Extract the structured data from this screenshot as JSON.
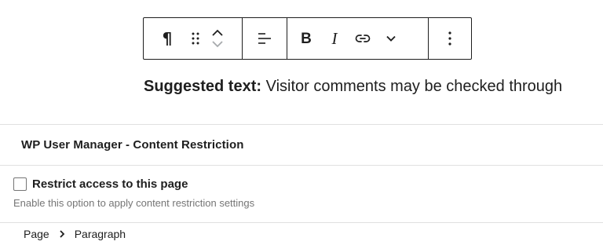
{
  "toolbar": {
    "block_type": {
      "icon": "paragraph-icon",
      "glyph": "¶"
    },
    "drag": {
      "icon": "drag-handle-icon"
    },
    "move_up": {
      "icon": "chevron-up-icon"
    },
    "move_down": {
      "icon": "chevron-down-icon"
    },
    "align": {
      "icon": "align-left-icon"
    },
    "bold": {
      "icon": "bold-icon",
      "glyph": "B"
    },
    "italic": {
      "icon": "italic-icon",
      "glyph": "I"
    },
    "link": {
      "icon": "link-icon"
    },
    "more_formatting": {
      "icon": "chevron-down-icon"
    },
    "options": {
      "icon": "more-vertical-icon"
    }
  },
  "content": {
    "suggested_label": "Suggested text:",
    "suggested_text": " Visitor comments may be checked through"
  },
  "panel": {
    "title": "WP User Manager - Content Restriction",
    "checkbox_label": "Restrict access to this page",
    "checkbox_checked": false,
    "help_text": "Enable this option to apply content restriction settings"
  },
  "breadcrumb": {
    "items": [
      "Page",
      "Paragraph"
    ],
    "separator_icon": "chevron-right-icon"
  },
  "colors": {
    "text": "#1e1e1e",
    "border": "#1e1e1e",
    "divider": "#e0e0e0",
    "muted": "#757575",
    "disabled": "#a7aaad"
  }
}
